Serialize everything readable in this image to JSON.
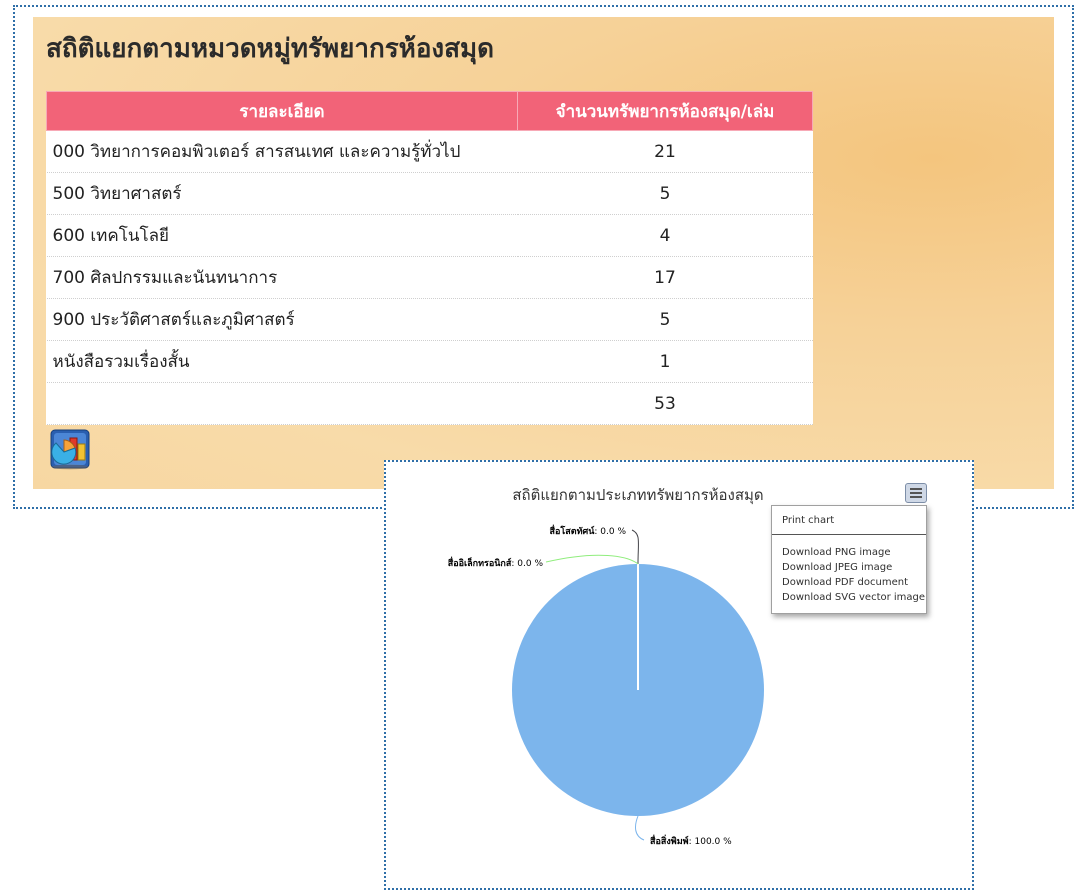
{
  "page": {
    "title": "สถิติแยกตามหมวดหมู่ทรัพยากรห้องสมุด"
  },
  "table": {
    "headers": [
      "รายละเอียด",
      "จำนวนทรัพยากรห้องสมุด/เล่ม"
    ],
    "rows": [
      {
        "label": "000 วิทยาการคอมพิวเตอร์ สารสนเทศ และความรู้ทั่วไป",
        "count": "21"
      },
      {
        "label": "500 วิทยาศาสตร์",
        "count": "5"
      },
      {
        "label": "600 เทคโนโลยี",
        "count": "4"
      },
      {
        "label": "700 ศิลปกรรมและนันทนาการ",
        "count": "17"
      },
      {
        "label": "900 ประวัติศาสตร์และภูมิศาสตร์",
        "count": "5"
      },
      {
        "label": "หนังสือรวมเรื่องสั้น",
        "count": "1"
      },
      {
        "label": "",
        "count": "53"
      }
    ],
    "header_color": "#f26378"
  },
  "icons": {
    "chart_launcher": "chart-launch-icon",
    "menu": "hamburger-menu-icon"
  },
  "export_menu": {
    "items": [
      "Print chart",
      "Download PNG image",
      "Download JPEG image",
      "Download PDF document",
      "Download SVG vector image"
    ]
  },
  "chart_data": {
    "type": "pie",
    "title": "สถิติแยกตามประเภททรัพยากรห้องสมุด",
    "slices": [
      {
        "name": "สื่อสิ่งพิมพ์",
        "value": 100.0,
        "label": "สื่อสิ่งพิมพ์: 100.0 %",
        "color": "#7cb5ec"
      },
      {
        "name": "สื่อโสตทัศน์",
        "value": 0.0,
        "label": "สื่อโสตทัศน์: 0.0 %",
        "color": "#434348"
      },
      {
        "name": "สื่ออิเล็กทรอนิกส์",
        "value": 0.0,
        "label": "สื่ออิเล็กทรอนิกส์: 0.0 %",
        "color": "#90ed7d"
      }
    ],
    "unit": "%"
  }
}
